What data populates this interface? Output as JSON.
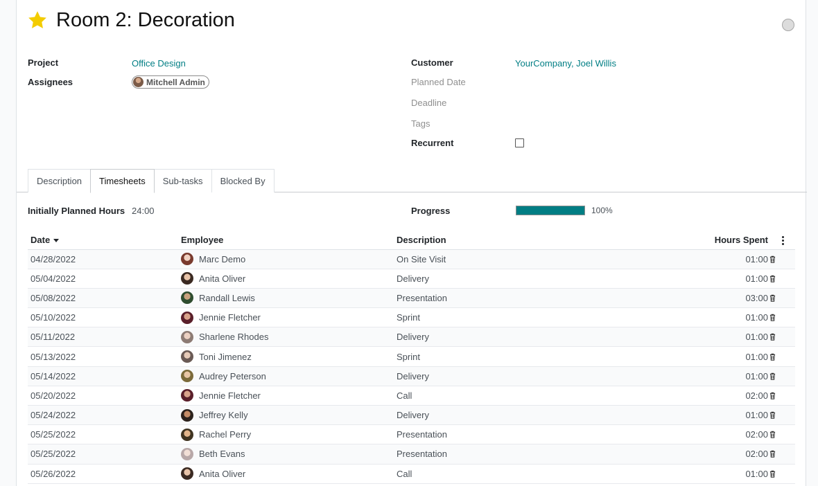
{
  "task": {
    "title": "Room 2: Decoration",
    "starred": true
  },
  "fields": {
    "project_label": "Project",
    "project_value": "Office Design",
    "assignees_label": "Assignees",
    "assignee_chip": "Mitchell Admin",
    "customer_label": "Customer",
    "customer_value": "YourCompany, Joel Willis",
    "planned_date_label": "Planned Date",
    "deadline_label": "Deadline",
    "tags_label": "Tags",
    "recurrent_label": "Recurrent",
    "recurrent_checked": false
  },
  "tabs": [
    {
      "label": "Description",
      "active": false
    },
    {
      "label": "Timesheets",
      "active": true
    },
    {
      "label": "Sub-tasks",
      "active": false
    },
    {
      "label": "Blocked By",
      "active": false
    }
  ],
  "timesheet_summary": {
    "planned_hours_label": "Initially Planned Hours",
    "planned_hours_value": "24:00",
    "progress_label": "Progress",
    "progress_percent": 100,
    "progress_text": "100%"
  },
  "table": {
    "columns": {
      "date": "Date",
      "employee": "Employee",
      "description": "Description",
      "hours": "Hours Spent"
    },
    "rows": [
      {
        "date": "04/28/2022",
        "employee": "Marc Demo",
        "description": "On Site Visit",
        "hours": "01:00"
      },
      {
        "date": "05/04/2022",
        "employee": "Anita Oliver",
        "description": "Delivery",
        "hours": "01:00"
      },
      {
        "date": "05/08/2022",
        "employee": "Randall Lewis",
        "description": "Presentation",
        "hours": "03:00"
      },
      {
        "date": "05/10/2022",
        "employee": "Jennie Fletcher",
        "description": "Sprint",
        "hours": "01:00"
      },
      {
        "date": "05/11/2022",
        "employee": "Sharlene Rhodes",
        "description": "Delivery",
        "hours": "01:00"
      },
      {
        "date": "05/13/2022",
        "employee": "Toni Jimenez",
        "description": "Sprint",
        "hours": "01:00"
      },
      {
        "date": "05/14/2022",
        "employee": "Audrey Peterson",
        "description": "Delivery",
        "hours": "01:00"
      },
      {
        "date": "05/20/2022",
        "employee": "Jennie Fletcher",
        "description": "Call",
        "hours": "02:00"
      },
      {
        "date": "05/24/2022",
        "employee": "Jeffrey Kelly",
        "description": "Delivery",
        "hours": "01:00"
      },
      {
        "date": "05/25/2022",
        "employee": "Rachel Perry",
        "description": "Presentation",
        "hours": "02:00"
      },
      {
        "date": "05/25/2022",
        "employee": "Beth Evans",
        "description": "Presentation",
        "hours": "02:00"
      },
      {
        "date": "05/26/2022",
        "employee": "Anita Oliver",
        "description": "Call",
        "hours": "01:00"
      }
    ]
  },
  "colors": {
    "accent": "#017e84",
    "star": "#f3cc00"
  },
  "icons": {
    "star": "star-icon",
    "status": "status-circle-icon",
    "sort": "sort-descending-icon",
    "delete": "trash-icon",
    "options": "kebab-menu-icon"
  }
}
